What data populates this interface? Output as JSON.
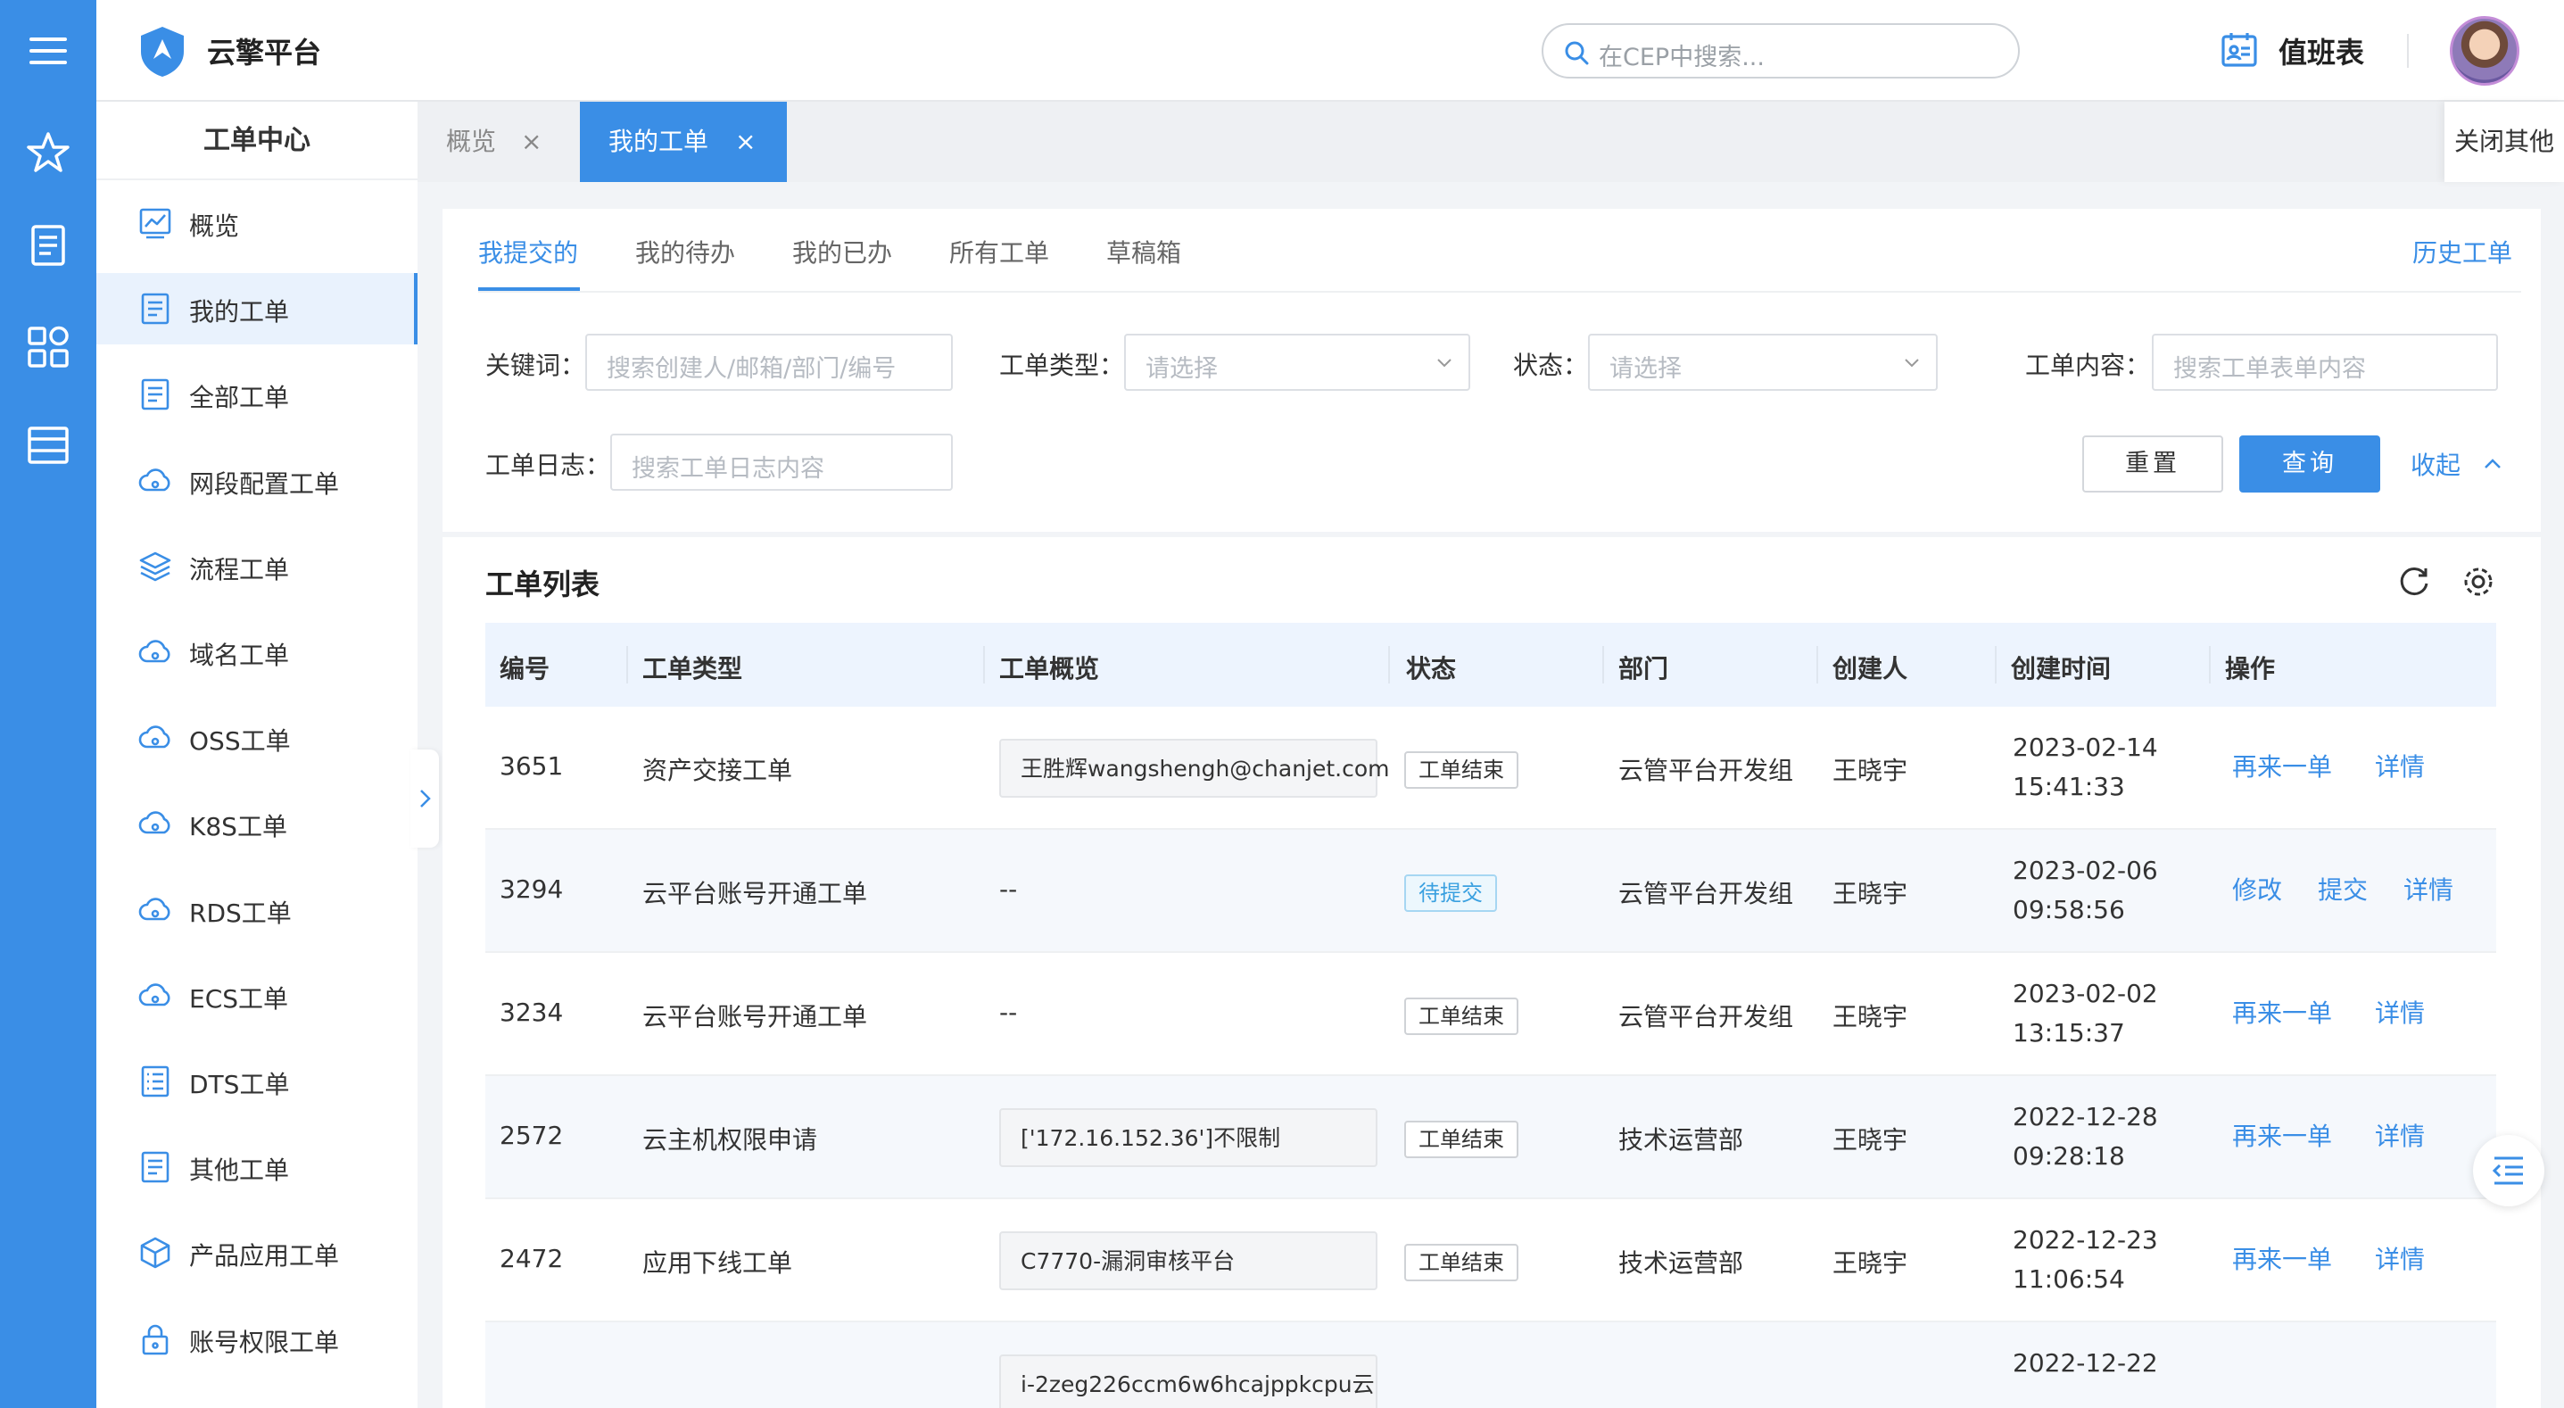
{
  "app": {
    "brand_name": "云擎平台"
  },
  "header": {
    "search_placeholder": "在CEP中搜索...",
    "duty_label": "值班表"
  },
  "rail": {
    "icons": [
      "menu-icon",
      "star-icon",
      "document-icon",
      "apps-icon",
      "table-icon"
    ]
  },
  "sidebar": {
    "title": "工单中心",
    "items": [
      {
        "label": "概览",
        "icon": "chart-icon"
      },
      {
        "label": "我的工单",
        "icon": "document-icon",
        "active": true
      },
      {
        "label": "全部工单",
        "icon": "document-icon"
      },
      {
        "label": "网段配置工单",
        "icon": "cloud-icon"
      },
      {
        "label": "流程工单",
        "icon": "layers-icon"
      },
      {
        "label": "域名工单",
        "icon": "cloud-icon"
      },
      {
        "label": "OSS工单",
        "icon": "cloud-icon"
      },
      {
        "label": "K8S工单",
        "icon": "cloud-icon"
      },
      {
        "label": "RDS工单",
        "icon": "cloud-icon"
      },
      {
        "label": "ECS工单",
        "icon": "cloud-icon"
      },
      {
        "label": "DTS工单",
        "icon": "list-icon"
      },
      {
        "label": "其他工单",
        "icon": "document-icon"
      },
      {
        "label": "产品应用工单",
        "icon": "cube-icon"
      },
      {
        "label": "账号权限工单",
        "icon": "lock-icon"
      }
    ]
  },
  "page_tabs": {
    "tabs": [
      {
        "label": "概览",
        "active": false
      },
      {
        "label": "我的工单",
        "active": true
      }
    ],
    "close_others": "关闭其他"
  },
  "filters": {
    "subtabs": [
      "我提交的",
      "我的待办",
      "我的已办",
      "所有工单",
      "草稿箱"
    ],
    "active_subtab": "我提交的",
    "history": "历史工单",
    "keyword": {
      "label": "关键词：",
      "placeholder": "搜索创建人/邮箱/部门/编号"
    },
    "type": {
      "label": "工单类型：",
      "placeholder": "请选择"
    },
    "status": {
      "label": "状态：",
      "placeholder": "请选择"
    },
    "content": {
      "label": "工单内容：",
      "placeholder": "搜索工单表单内容"
    },
    "log": {
      "label": "工单日志：",
      "placeholder": "搜索工单日志内容"
    },
    "reset": "重置",
    "query": "查询",
    "collapse": "收起"
  },
  "list": {
    "title": "工单列表",
    "columns": [
      "编号",
      "工单类型",
      "工单概览",
      "状态",
      "部门",
      "创建人",
      "创建时间",
      "操作"
    ],
    "rows": [
      {
        "id": "3651",
        "type": "资产交接工单",
        "summary": "王胜辉wangshengh@chanjet.com",
        "status": "工单结束",
        "dept": "云管平台开发组",
        "creator": "王晓宇",
        "date": "2023-02-14",
        "time": "15:41:33",
        "actions": [
          "再来一单",
          "详情"
        ]
      },
      {
        "id": "3294",
        "type": "云平台账号开通工单",
        "summary": "--",
        "status": "待提交",
        "dept": "云管平台开发组",
        "creator": "王晓宇",
        "date": "2023-02-06",
        "time": "09:58:56",
        "actions": [
          "修改",
          "提交",
          "详情"
        ]
      },
      {
        "id": "3234",
        "type": "云平台账号开通工单",
        "summary": "--",
        "status": "工单结束",
        "dept": "云管平台开发组",
        "creator": "王晓宇",
        "date": "2023-02-02",
        "time": "13:15:37",
        "actions": [
          "再来一单",
          "详情"
        ]
      },
      {
        "id": "2572",
        "type": "云主机权限申请",
        "summary": "['172.16.152.36']不限制",
        "status": "工单结束",
        "dept": "技术运营部",
        "creator": "王晓宇",
        "date": "2022-12-28",
        "time": "09:28:18",
        "actions": [
          "再来一单",
          "详情"
        ]
      },
      {
        "id": "2472",
        "type": "应用下线工单",
        "summary": "C7770-漏洞审核平台",
        "status": "工单结束",
        "dept": "技术运营部",
        "creator": "王晓宇",
        "date": "2022-12-23",
        "time": "11:06:54",
        "actions": [
          "再来一单",
          "详情"
        ]
      },
      {
        "id": "",
        "type": "",
        "summary": "i-2zeg226ccm6w6hcajppkcpu云",
        "status": "",
        "dept": "",
        "creator": "",
        "date": "2022-12-22",
        "time": "",
        "actions": []
      }
    ]
  },
  "colors": {
    "primary": "#3a8ee6",
    "rail": "#3a8ee6",
    "header_bg": "#edf4fe"
  }
}
